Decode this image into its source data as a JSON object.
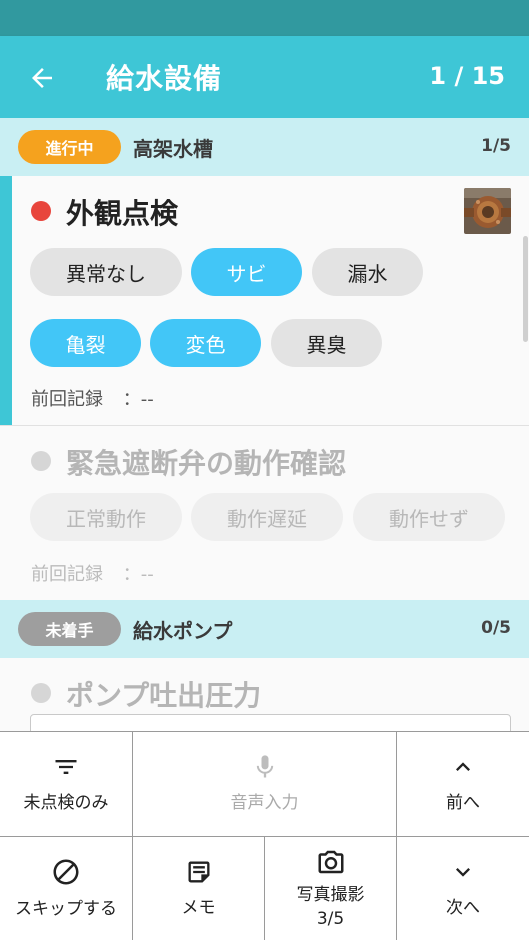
{
  "header": {
    "title": "給水設備",
    "counter": "1 / 15"
  },
  "sections": [
    {
      "status": "進行中",
      "status_color": "#f5a21e",
      "name": "高架水槽",
      "count": "1/5",
      "items": [
        {
          "title": "外観点検",
          "dot_color": "#e8453c",
          "chips": [
            {
              "label": "異常なし",
              "selected": false
            },
            {
              "label": "サビ",
              "selected": true
            },
            {
              "label": "漏水",
              "selected": false
            },
            {
              "label": "亀裂",
              "selected": true
            },
            {
              "label": "変色",
              "selected": true
            },
            {
              "label": "異臭",
              "selected": false
            }
          ],
          "prev_label": "前回記録",
          "prev_value": "：--"
        },
        {
          "title": "緊急遮断弁の動作確認",
          "dot_color": "#d6d6d6",
          "chips": [
            {
              "label": "正常動作",
              "selected": false
            },
            {
              "label": "動作遅延",
              "selected": false
            },
            {
              "label": "動作せず",
              "selected": false
            }
          ],
          "prev_label": "前回記録",
          "prev_value": "：--"
        }
      ]
    },
    {
      "status": "未着手",
      "status_color": "#9e9e9e",
      "name": "給水ポンプ",
      "count": "0/5",
      "items": [
        {
          "title": "ポンプ吐出圧力",
          "dot_color": "#d6d6d6"
        }
      ]
    }
  ],
  "toolbar": {
    "filter_label": "未点検のみ",
    "voice_label": "音声入力",
    "prev_label": "前へ",
    "skip_label": "スキップする",
    "memo_label": "メモ",
    "photo_label": "写真撮影",
    "photo_count": "3/5",
    "next_label": "次へ"
  },
  "icons": {
    "back": "arrow-left-icon",
    "filter": "filter-icon",
    "mic": "microphone-icon",
    "up": "chevron-up-icon",
    "skip": "block-icon",
    "memo": "note-icon",
    "camera": "camera-icon",
    "down": "chevron-down-icon"
  },
  "colors": {
    "primary": "#3ec6d6",
    "status_bar": "#31999f",
    "section_bg": "#c9eff3",
    "chip_selected": "#42c6f7"
  }
}
